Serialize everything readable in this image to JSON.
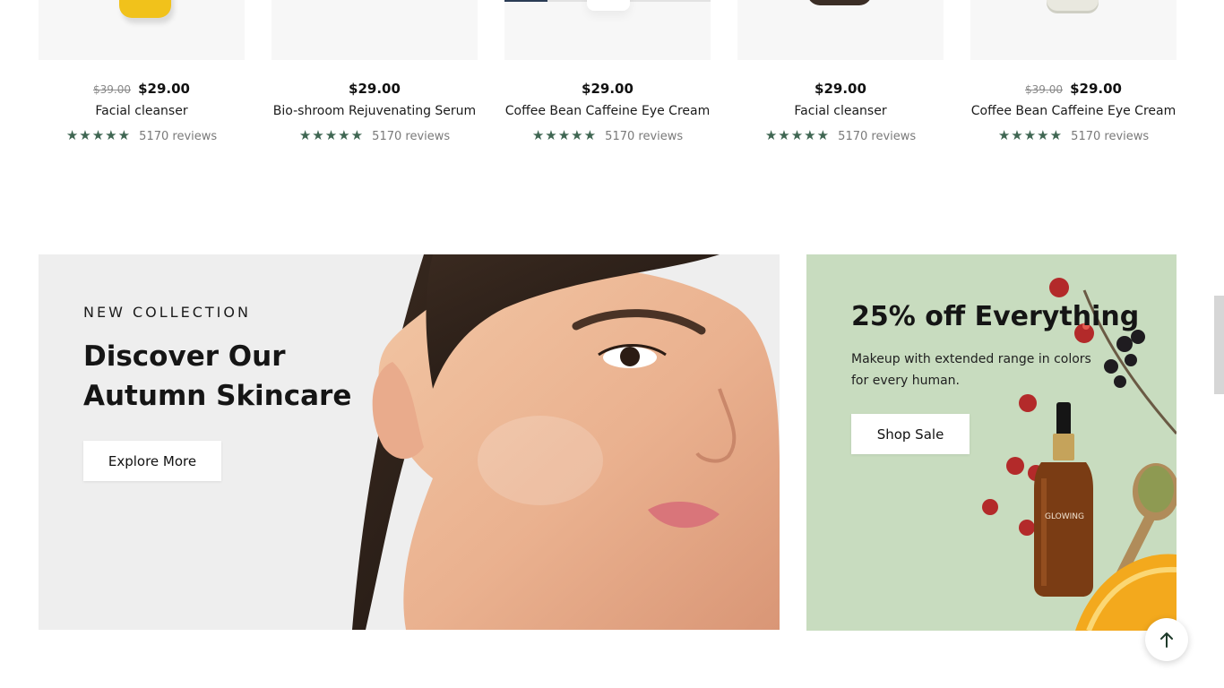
{
  "products": [
    {
      "old_price": "$39.00",
      "price": "$29.00",
      "name": "Facial cleanser",
      "stars": "★★★★★",
      "rating": 5,
      "reviews": "5170 reviews",
      "image_icon": "yellow-bottle"
    },
    {
      "old_price": "",
      "price": "$29.00",
      "name": "Bio-shroom Rejuvenating Serum",
      "stars": "★★★★★",
      "rating": 5,
      "reviews": "5170 reviews",
      "image_icon": "blank"
    },
    {
      "old_price": "",
      "price": "$29.00",
      "name": "Coffee Bean Caffeine Eye Cream",
      "stars": "★★★★★",
      "rating": 5,
      "reviews": "5170 reviews",
      "image_icon": "white-jar"
    },
    {
      "old_price": "",
      "price": "$29.00",
      "name": "Facial cleanser",
      "stars": "★★★★★",
      "rating": 5,
      "reviews": "5170 reviews",
      "image_icon": "dark-jar"
    },
    {
      "old_price": "$39.00",
      "price": "$29.00",
      "name": "Coffee Bean Caffeine Eye Cream",
      "stars": "★★★★★",
      "rating": 5,
      "reviews": "5170 reviews",
      "image_icon": "cream-jar"
    }
  ],
  "banner_left": {
    "eyebrow": "NEW COLLECTION",
    "headline": "Discover Our Autumn Skincare",
    "button": "Explore More",
    "image_icon": "model-face"
  },
  "banner_right": {
    "title": "25% off Everything",
    "text": "Makeup with extended range in colors for every human.",
    "button": "Shop Sale",
    "bottle_label": "GLOWING",
    "image_icon": "serum-bottle-berries"
  },
  "scroll_top_icon": "arrow-up-icon",
  "colors": {
    "star": "#3f6652",
    "promo_background": "#c8dcbf",
    "banner_background": "#eeeeee",
    "thumb_background": "#f7f7f7"
  }
}
